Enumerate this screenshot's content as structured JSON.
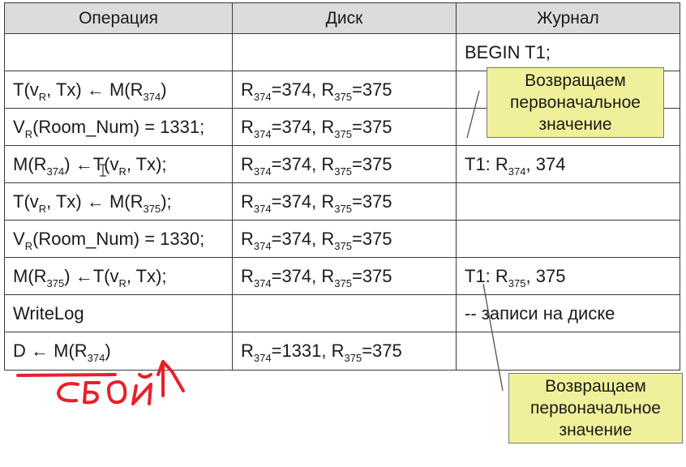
{
  "headers": {
    "operation": "Операция",
    "disk": "Диск",
    "log": "Журнал"
  },
  "rows": [
    {
      "op": [],
      "disk": [],
      "log": [
        "BEGIN T1;"
      ]
    },
    {
      "op": [
        "T(v",
        "R",
        ", Tx) ← M(R",
        "374",
        ")"
      ],
      "disk": [
        "R",
        "374",
        "=374, R",
        "375",
        "=375"
      ],
      "log": []
    },
    {
      "op": [
        "V",
        "R",
        "(Room_Num) = 1331;"
      ],
      "disk": [
        "R",
        "374",
        "=374, R",
        "375",
        "=375"
      ],
      "log": []
    },
    {
      "op": [
        "M(R",
        "374",
        ") ←T(v",
        "R",
        ", Tx);"
      ],
      "disk": [
        "R",
        "374",
        "=374, R",
        "375",
        "=375"
      ],
      "log": [
        "T1: R",
        "374",
        ", 374"
      ]
    },
    {
      "op": [
        "T(v",
        "R",
        ", Tx) ← M(R",
        "375",
        ");"
      ],
      "disk": [
        "R",
        "374",
        "=374, R",
        "375",
        "=375"
      ],
      "log": []
    },
    {
      "op": [
        "V",
        "R",
        "(Room_Num) = 1330;"
      ],
      "disk": [
        "R",
        "374",
        "=374, R",
        "375",
        "=375"
      ],
      "log": []
    },
    {
      "op": [
        "M(R",
        "375",
        ") ←T(v",
        "R",
        ", Tx);"
      ],
      "disk": [
        "R",
        "374",
        "=374, R",
        "375",
        "=375"
      ],
      "log": [
        "T1: R",
        "375",
        ", 375"
      ]
    },
    {
      "op": [
        "WriteLog"
      ],
      "disk": [],
      "log": [
        "-- записи на диске"
      ]
    },
    {
      "op": [
        "D ← M(R",
        "374",
        ")"
      ],
      "disk": [
        "R",
        "374",
        "=1331, R",
        "375",
        "=375"
      ],
      "log": []
    }
  ],
  "notes": {
    "top": [
      "Возвращаем",
      "первоначальное",
      "значение"
    ],
    "bottom": [
      "Возвращаем",
      "первоначальное",
      "значение"
    ]
  },
  "handwriting": "сбой",
  "colors": {
    "header_bg": "#dcdcdc",
    "note_bg": "#f0f09a",
    "ink_red": "#e8202a"
  }
}
